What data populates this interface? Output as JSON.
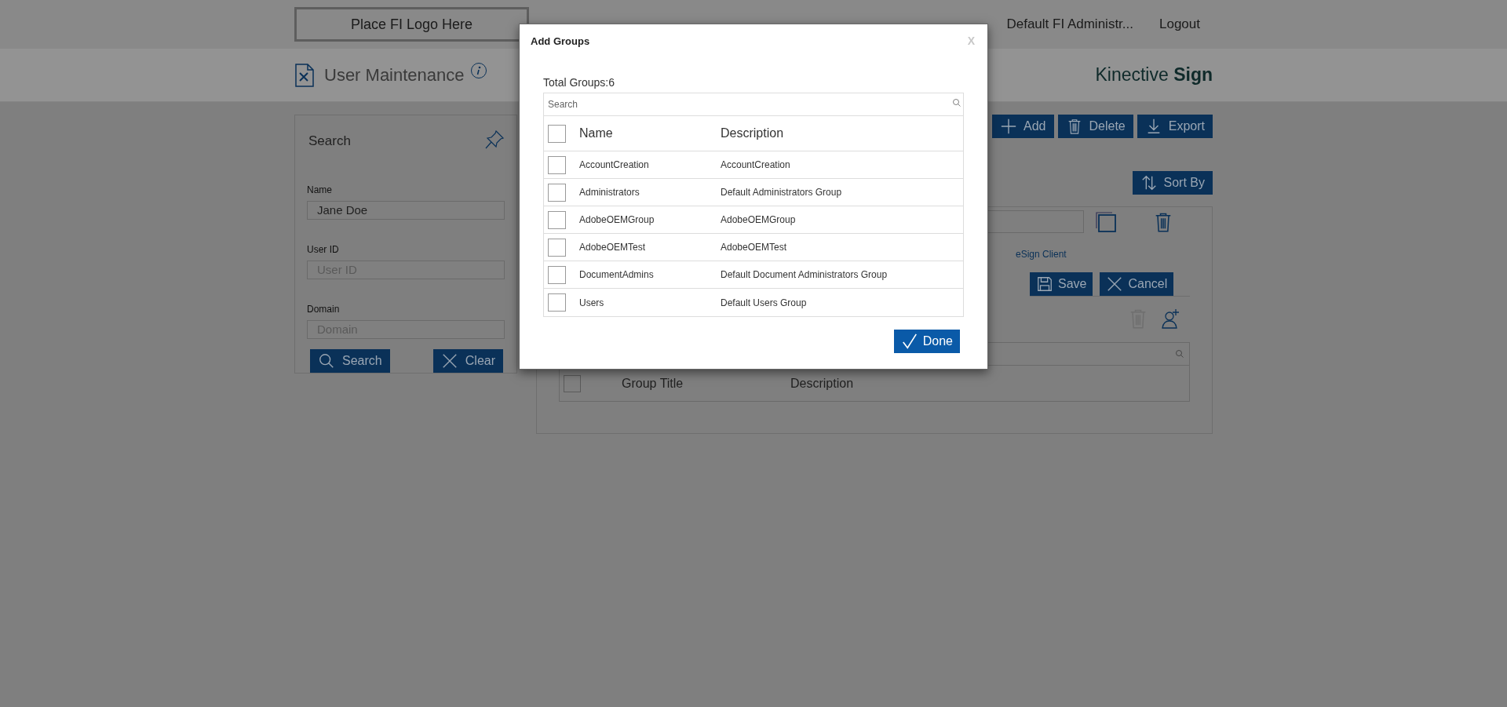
{
  "header": {
    "logo": "Place FI Logo Here",
    "nav": [
      "Default FI Administr...",
      "Logout"
    ]
  },
  "page": {
    "title": "User Maintenance",
    "brand": "Kinective **Sign**"
  },
  "search_panel": {
    "title": "Search",
    "fields": [
      {
        "label": "Name",
        "value": "Jane Doe"
      },
      {
        "label": "User ID",
        "placeholder": "User ID"
      },
      {
        "label": "Domain",
        "placeholder": "Domain"
      }
    ],
    "buttons": [
      {
        "label": "Search",
        "kind": "search"
      },
      {
        "label": "Clear",
        "kind": "close"
      }
    ]
  },
  "toolbar": [
    {
      "label": "Add",
      "kind": "plus"
    },
    {
      "label": "Delete",
      "kind": "trash"
    },
    {
      "label": "Export",
      "kind": "download"
    }
  ],
  "sort_button": {
    "label": "Sort By",
    "kind": "sort"
  },
  "detail": {
    "link": "eSign Client",
    "buttons": [
      {
        "label": "Save",
        "kind": "save"
      },
      {
        "label": "Cancel",
        "kind": "close"
      }
    ],
    "groups_table": {
      "columns": [
        "Group Title",
        "Description"
      ],
      "header_checked": false
    }
  },
  "modal": {
    "title": "Add Groups",
    "close": "X",
    "total": "Total Groups:6",
    "search_placeholder": "Search",
    "columns": [
      "Name",
      "Description"
    ],
    "header_checked": false,
    "rows": [
      {
        "name": "AccountCreation",
        "description": "AccountCreation",
        "checked": false
      },
      {
        "name": "Administrators",
        "description": "Default Administrators Group",
        "checked": false
      },
      {
        "name": "AdobeOEMGroup",
        "description": "AdobeOEMGroup",
        "checked": false
      },
      {
        "name": "AdobeOEMTest",
        "description": "AdobeOEMTest",
        "checked": false
      },
      {
        "name": "DocumentAdmins",
        "description": "Default Document Administrators Group",
        "checked": false
      },
      {
        "name": "Users",
        "description": "Default Users Group",
        "checked": false
      }
    ],
    "done": {
      "label": "Done",
      "kind": "check"
    }
  }
}
